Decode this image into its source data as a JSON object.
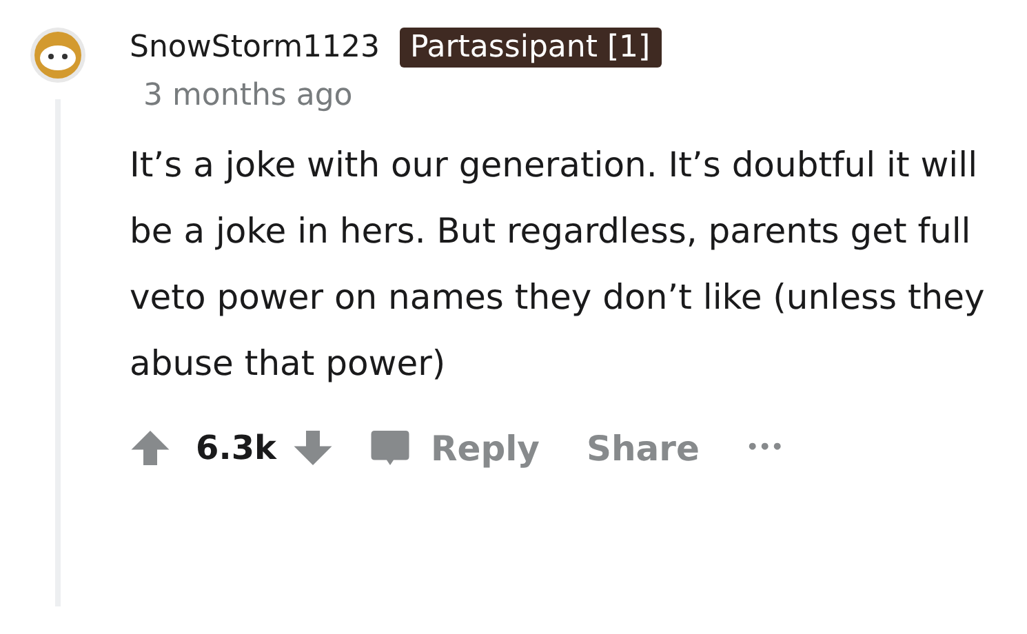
{
  "comment": {
    "username": "SnowStorm1123",
    "flair": "Partassipant [1]",
    "time": "3 months ago",
    "body": "It’s a joke with our generation. It’s doubtful it will be a joke in hers. But regardless, parents get full veto power on names they don’t like (unless they abuse that power)",
    "score": "6.3k",
    "actions": [
      {
        "kind": "reply",
        "label": "Reply"
      },
      {
        "kind": "share",
        "label": "Share"
      },
      {
        "kind": "more",
        "label": "•••"
      }
    ]
  }
}
